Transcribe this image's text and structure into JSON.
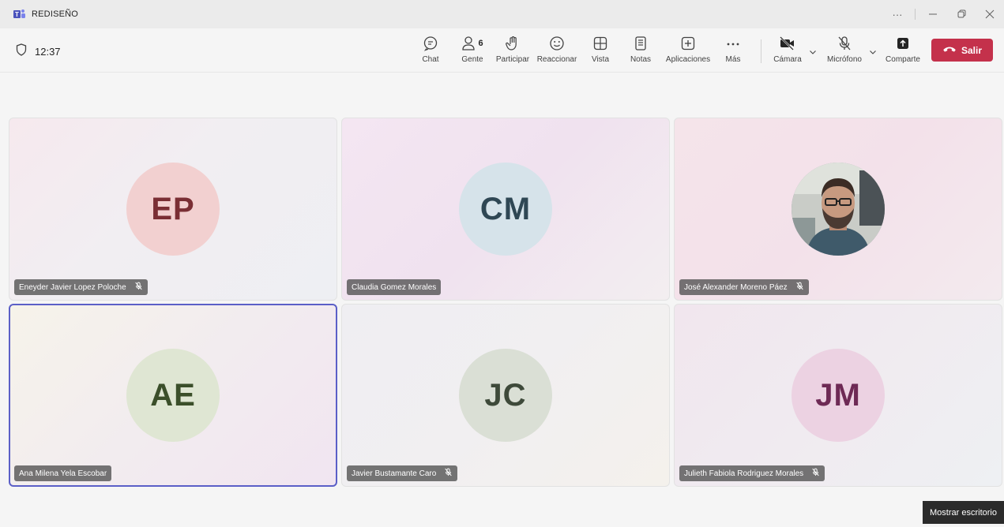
{
  "window": {
    "title": "REDISEÑO",
    "more_glyph": "···"
  },
  "toolbar": {
    "timer": "12:37",
    "chat": "Chat",
    "people": "Gente",
    "people_count": "6",
    "raise": "Participar",
    "react": "Reaccionar",
    "view": "Vista",
    "notes": "Notas",
    "apps": "Aplicaciones",
    "more": "Más",
    "camera": "Cámara",
    "mic": "Micrófono",
    "share": "Comparte",
    "leave": "Salir"
  },
  "participants": [
    {
      "name": "Eneyder Javier Lopez Poloche",
      "initials": "EP",
      "muted": true,
      "avatar_bg": "#f2d0d0",
      "avatar_fg": "#7a2e34"
    },
    {
      "name": "Claudia Gomez Morales",
      "initials": "CM",
      "muted": false,
      "avatar_bg": "#d6e3ea",
      "avatar_fg": "#2f4754"
    },
    {
      "name": "José Alexander Moreno Páez",
      "initials": "",
      "muted": true,
      "photo": true
    },
    {
      "name": "Ana Milena Yela Escobar",
      "initials": "AE",
      "muted": false,
      "avatar_bg": "#dfe6d3",
      "avatar_fg": "#3b4f2a"
    },
    {
      "name": "Javier Bustamante Caro",
      "initials": "JC",
      "muted": true,
      "avatar_bg": "#dadfd5",
      "avatar_fg": "#3e4a3a"
    },
    {
      "name": "Julieth Fabiola Rodriguez Morales",
      "initials": "JM",
      "muted": true,
      "avatar_bg": "#ecd2e2",
      "avatar_fg": "#6e2a55"
    }
  ],
  "tooltip": "Mostrar escritorio",
  "colors": {
    "accent": "#5b5fc7",
    "leave": "#c4314b"
  }
}
